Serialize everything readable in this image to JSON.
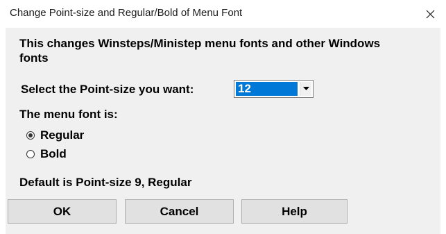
{
  "window": {
    "title": "Change Point-size and Regular/Bold of Menu Font"
  },
  "dialog": {
    "description": "This changes Winsteps/Ministep menu fonts and other Windows fonts",
    "point_size_label": "Select the Point-size you want:",
    "point_size_selected": "12",
    "menu_font_label": "The menu font is:",
    "options": [
      {
        "label": "Regular",
        "selected": true
      },
      {
        "label": "Bold",
        "selected": false
      }
    ],
    "default_note": "Default is Point-size 9, Regular"
  },
  "buttons": {
    "ok": "OK",
    "cancel": "Cancel",
    "help": "Help"
  },
  "colors": {
    "selection_highlight": "#0078d7",
    "dialog_background": "#f0f0f0",
    "button_background": "#e1e1e1"
  },
  "icons": {
    "close": "close-icon",
    "dropdown": "chevron-down-icon"
  }
}
